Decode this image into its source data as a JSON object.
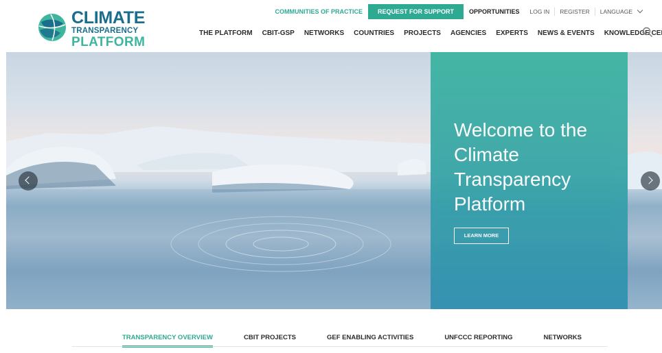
{
  "logo": {
    "line1": "CLIMATE",
    "line2": "TRANSPARENCY",
    "line3": "PLATFORM"
  },
  "topbar": {
    "communities": "COMMUNITIES OF PRACTICE",
    "request": "REQUEST FOR SUPPORT",
    "opportunities": "OPPORTUNITIES",
    "login": "LOG IN",
    "register": "REGISTER",
    "language": "LANGUAGE"
  },
  "nav": [
    "THE PLATFORM",
    "CBIT-GSP",
    "NETWORKS",
    "COUNTRIES",
    "PROJECTS",
    "AGENCIES",
    "EXPERTS",
    "NEWS & EVENTS",
    "KNOWLEDGE CENTRE"
  ],
  "hero": {
    "title": "Welcome to the Climate Transparency Platform",
    "button": "LEARN MORE"
  },
  "tabs": [
    "TRANSPARENCY OVERVIEW",
    "CBIT PROJECTS",
    "GEF ENABLING ACTIVITIES",
    "UNFCCC REPORTING",
    "NETWORKS"
  ],
  "active_tab": "TRANSPARENCY OVERVIEW",
  "colors": {
    "accent": "#2eaa93",
    "brand_dark": "#1a6e8c"
  }
}
